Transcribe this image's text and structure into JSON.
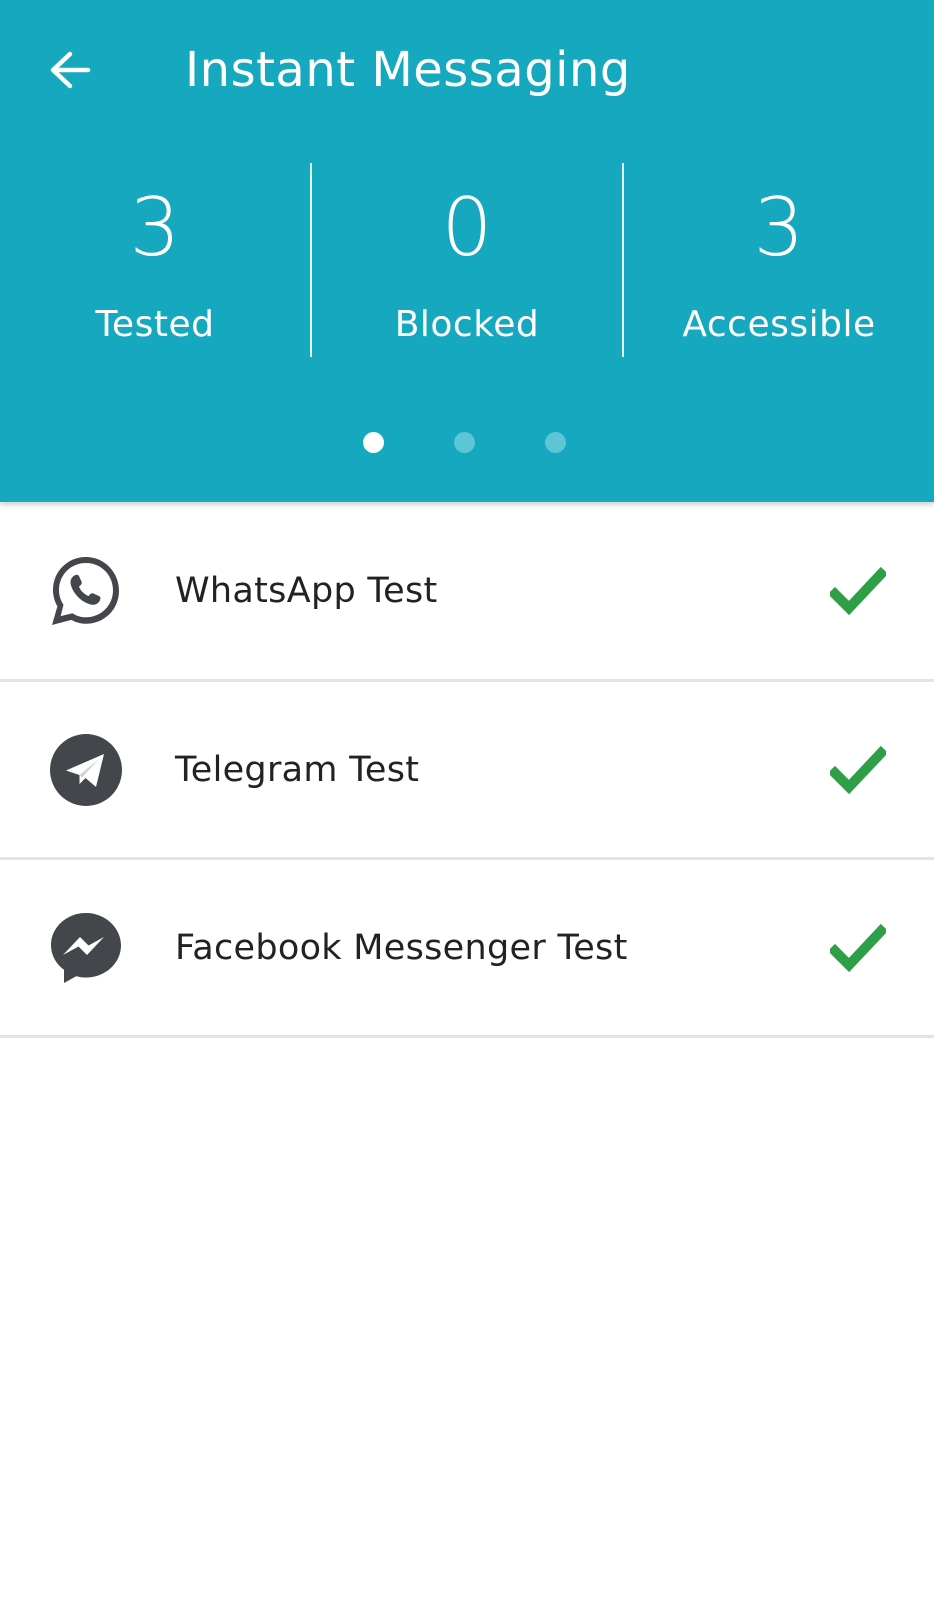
{
  "header": {
    "title": "Instant Messaging",
    "background_color": "#16a8be",
    "back_icon": "arrow-left-icon"
  },
  "stats": [
    {
      "value": "3",
      "label": "Tested"
    },
    {
      "value": "0",
      "label": "Blocked"
    },
    {
      "value": "3",
      "label": "Accessible"
    }
  ],
  "pager": {
    "count": 3,
    "active_index": 0
  },
  "tests": [
    {
      "label": "WhatsApp Test",
      "icon": "whatsapp-icon",
      "status": "accessible",
      "status_icon": "checkmark-icon"
    },
    {
      "label": "Telegram Test",
      "icon": "telegram-icon",
      "status": "accessible",
      "status_icon": "checkmark-icon"
    },
    {
      "label": "Facebook Messenger Test",
      "icon": "messenger-icon",
      "status": "accessible",
      "status_icon": "checkmark-icon"
    }
  ],
  "colors": {
    "accent": "#16a8be",
    "success": "#2e9e47",
    "icon_gray": "#43474b",
    "divider": "#e3e3e3"
  }
}
